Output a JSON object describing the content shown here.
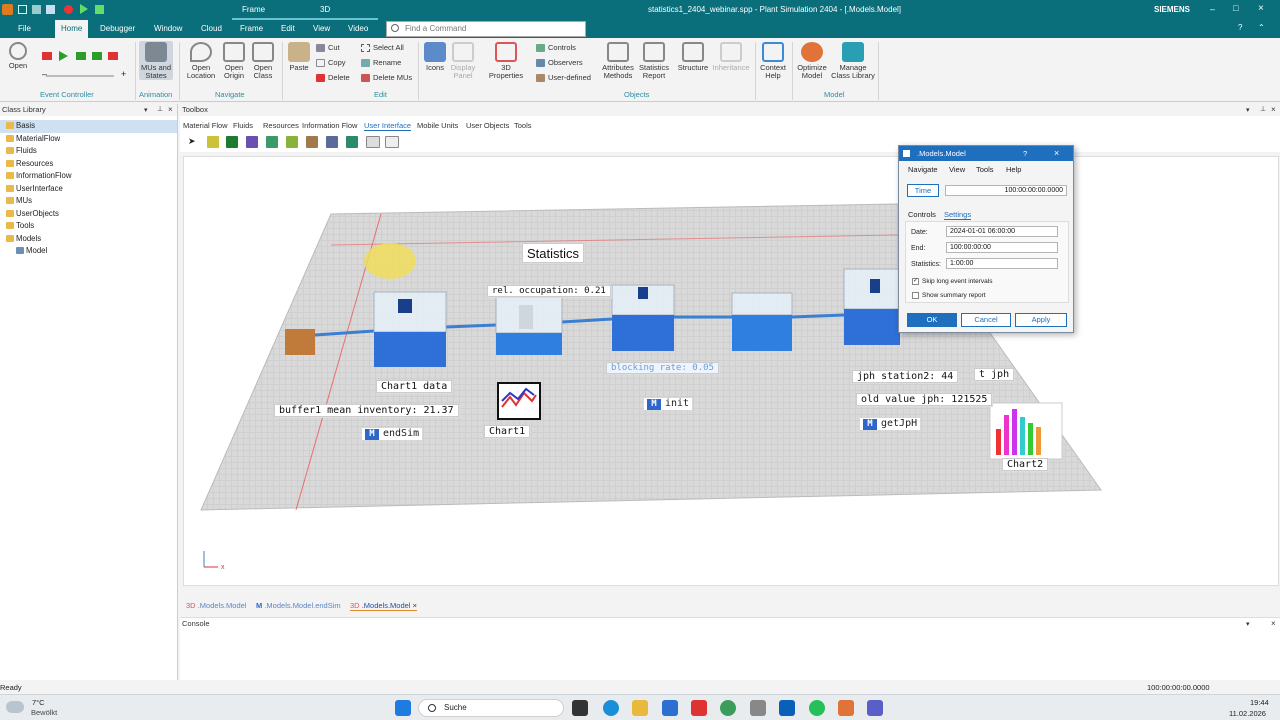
{
  "titlebar": {
    "context_group": "Frame",
    "context_tab": "3D",
    "title": "statistics1_2404_webinar.spp - Plant Simulation 2404 - [.Models.Model]",
    "brand": "SIEMENS"
  },
  "tabs": [
    "File",
    "Home",
    "Debugger",
    "Window",
    "Cloud",
    "Frame",
    "Edit",
    "View",
    "Video"
  ],
  "search": {
    "placeholder": "Find a Command"
  },
  "ribbon": {
    "open": "Open",
    "mus_states": "MUs and States",
    "open_location": "Open Location",
    "open_origin": "Open Origin",
    "open_class": "Open Class",
    "paste": "Paste",
    "cut": "Cut",
    "copy": "Copy",
    "delete": "Delete",
    "select_all": "Select All",
    "rename": "Rename",
    "delete_mus": "Delete MUs",
    "icons": "Icons",
    "display_panel": "Display Panel",
    "properties_3d": "3D Properties",
    "controls": "Controls",
    "observers": "Observers",
    "user_defined": "User-defined",
    "attributes_methods": "Attributes Methods",
    "statistics_report": "Statistics Report",
    "structure": "Structure",
    "inheritance": "Inheritance",
    "context_help": "Context Help",
    "optimize_model": "Optimize Model",
    "manage_library": "Manage Class Library",
    "groups": {
      "event_controller": "Event Controller",
      "animation": "Animation",
      "navigate": "Navigate",
      "edit": "Edit",
      "objects": "Objects",
      "model": "Model"
    }
  },
  "class_library": {
    "title": "Class Library",
    "items": [
      "Basis",
      "MaterialFlow",
      "Fluids",
      "Resources",
      "InformationFlow",
      "UserInterface",
      "MUs",
      "UserObjects",
      "Tools",
      "Models",
      "Model"
    ]
  },
  "toolbox": {
    "title": "Toolbox",
    "tabs": [
      "Material Flow",
      "Fluids",
      "Resources",
      "Information Flow",
      "User Interface",
      "Mobile Units",
      "User Objects",
      "Tools"
    ]
  },
  "scene": {
    "statistics": "Statistics",
    "rel_occupation": "rel. occupation: 0.21",
    "chart1_data": "Chart1 data",
    "buffer_label": "buffer1 mean inventory: 21.37",
    "endsim": "endSim",
    "chart1": "Chart1",
    "blocking_rate": "blocking rate: 0.05",
    "init": "init",
    "jph_station2": "jph station2: 44",
    "t_jph": "t jph",
    "old_value_jph": "old value jph: 121525",
    "getjph": "getJpH",
    "chart2": "Chart2"
  },
  "dialog": {
    "title": ".Models.Model",
    "help_q": "?",
    "close": "×",
    "menu": [
      "Navigate",
      "View",
      "Tools",
      "Help"
    ],
    "time_btn": "Time",
    "time_value": "100:00:00:00.0000",
    "tabs": [
      "Controls",
      "Settings"
    ],
    "date_label": "Date:",
    "date_value": "2024-01-01 06:00:00",
    "end_label": "End:",
    "end_value": "100:00:00:00",
    "statistics_label": "Statistics:",
    "statistics_value": "1:00:00",
    "skip_label": "Skip long event intervals",
    "summary_label": "Show summary report",
    "ok": "OK",
    "cancel": "Cancel",
    "apply": "Apply"
  },
  "doc_tabs": [
    {
      "prefix": "3D",
      "label": ".Models.Model"
    },
    {
      "prefix": "M",
      "label": ".Models.Model.endSim"
    },
    {
      "prefix": "3D",
      "label": ".Models.Model"
    }
  ],
  "console": {
    "title": "Console"
  },
  "status": {
    "left": "Ready",
    "right": "100:00:00:00.0000"
  },
  "taskbar": {
    "weather_temp": "7°C",
    "weather_desc": "Bewölkt",
    "search": "Suche",
    "time": "19:44",
    "date": "11.02.2026"
  },
  "colors": {
    "teal": "#0b6e7b",
    "accent": "#1f6fbf",
    "station_blue": "#2f7fe0"
  }
}
